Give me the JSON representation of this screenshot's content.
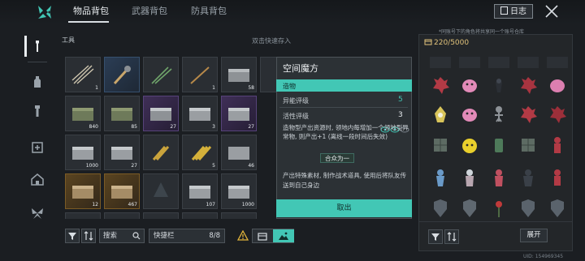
{
  "tabs": [
    {
      "label": "物品背包",
      "active": true
    },
    {
      "label": "武器背包",
      "active": false
    },
    {
      "label": "防具背包",
      "active": false
    }
  ],
  "header": {
    "log_label": "日志",
    "note": "*同账号下的角色将共享同一个账号仓库"
  },
  "grid": {
    "section_title": "工具",
    "hint": "双击快速存入",
    "row1_counts": [
      "1",
      "",
      "",
      "1",
      "58"
    ],
    "row2_counts": [
      "840",
      "85",
      "27",
      "3",
      "27"
    ],
    "row3_counts": [
      "1000",
      "27",
      "",
      "5",
      "46"
    ],
    "row4_counts": [
      "12",
      "467",
      "",
      "107",
      "1000"
    ]
  },
  "tooltip": {
    "title": "空间魔方",
    "category": "造物",
    "stats": [
      {
        "label": "异能评级",
        "value": "5",
        "color": "#42c7b5"
      },
      {
        "label": "活性评级",
        "value": "3",
        "color": "#e9edf0"
      }
    ],
    "effect": "造物型产出资源时, 领地内每增加一个领地型异常物, 则产出+1 (离线一段时间后失效)",
    "badge": "合众为一",
    "description": "产出特殊素材, 制作战术道具, 使用后将队友传送到自己身边",
    "cancel_label": "取出"
  },
  "bottom": {
    "search_label": "搜索",
    "quickbar_label": "快捷栏",
    "quickbar_count": "8/8"
  },
  "storage": {
    "capacity": "220/5000",
    "expand_label": "展开",
    "uid": "UID: 154969345"
  },
  "colors": {
    "accent": "#42c7b5",
    "gold": "#e0c27a"
  }
}
